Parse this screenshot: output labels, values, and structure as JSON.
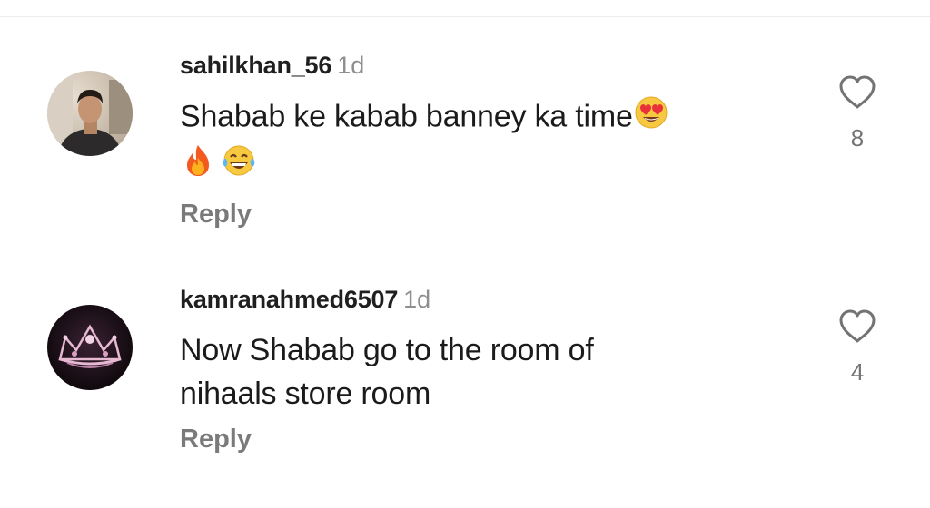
{
  "comments": [
    {
      "username": "sahilkhan_56",
      "time": "1d",
      "text_line1": "Shabab ke kabab banney ka time",
      "text_emoji_inline": "heart-eyes-emoji",
      "text_line2_emojis": [
        "fire-emoji",
        "tears-of-joy-emoji"
      ],
      "reply_label": "Reply",
      "like_count": "8",
      "avatar": "user-photo-avatar"
    },
    {
      "username": "kamranahmed6507",
      "time": "1d",
      "text_line1": "Now Shabab go to the room of",
      "text_line2": "nihaals store room",
      "reply_label": "Reply",
      "like_count": "4",
      "avatar": "crown-avatar"
    }
  ],
  "colors": {
    "secondary_text": "#8e8e8e",
    "reply_text": "#7a7a7a",
    "divider": "#ececec"
  }
}
